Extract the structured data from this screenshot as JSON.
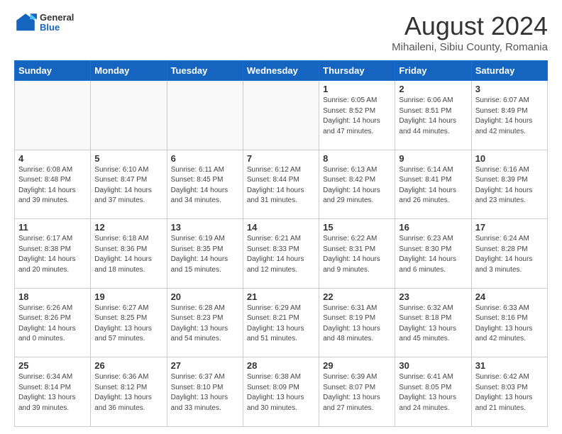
{
  "header": {
    "logo": {
      "line1": "General",
      "line2": "Blue"
    },
    "title": "August 2024",
    "location": "Mihaileni, Sibiu County, Romania"
  },
  "weekdays": [
    "Sunday",
    "Monday",
    "Tuesday",
    "Wednesday",
    "Thursday",
    "Friday",
    "Saturday"
  ],
  "weeks": [
    [
      {
        "day": "",
        "info": ""
      },
      {
        "day": "",
        "info": ""
      },
      {
        "day": "",
        "info": ""
      },
      {
        "day": "",
        "info": ""
      },
      {
        "day": "1",
        "info": "Sunrise: 6:05 AM\nSunset: 8:52 PM\nDaylight: 14 hours\nand 47 minutes."
      },
      {
        "day": "2",
        "info": "Sunrise: 6:06 AM\nSunset: 8:51 PM\nDaylight: 14 hours\nand 44 minutes."
      },
      {
        "day": "3",
        "info": "Sunrise: 6:07 AM\nSunset: 8:49 PM\nDaylight: 14 hours\nand 42 minutes."
      }
    ],
    [
      {
        "day": "4",
        "info": "Sunrise: 6:08 AM\nSunset: 8:48 PM\nDaylight: 14 hours\nand 39 minutes."
      },
      {
        "day": "5",
        "info": "Sunrise: 6:10 AM\nSunset: 8:47 PM\nDaylight: 14 hours\nand 37 minutes."
      },
      {
        "day": "6",
        "info": "Sunrise: 6:11 AM\nSunset: 8:45 PM\nDaylight: 14 hours\nand 34 minutes."
      },
      {
        "day": "7",
        "info": "Sunrise: 6:12 AM\nSunset: 8:44 PM\nDaylight: 14 hours\nand 31 minutes."
      },
      {
        "day": "8",
        "info": "Sunrise: 6:13 AM\nSunset: 8:42 PM\nDaylight: 14 hours\nand 29 minutes."
      },
      {
        "day": "9",
        "info": "Sunrise: 6:14 AM\nSunset: 8:41 PM\nDaylight: 14 hours\nand 26 minutes."
      },
      {
        "day": "10",
        "info": "Sunrise: 6:16 AM\nSunset: 8:39 PM\nDaylight: 14 hours\nand 23 minutes."
      }
    ],
    [
      {
        "day": "11",
        "info": "Sunrise: 6:17 AM\nSunset: 8:38 PM\nDaylight: 14 hours\nand 20 minutes."
      },
      {
        "day": "12",
        "info": "Sunrise: 6:18 AM\nSunset: 8:36 PM\nDaylight: 14 hours\nand 18 minutes."
      },
      {
        "day": "13",
        "info": "Sunrise: 6:19 AM\nSunset: 8:35 PM\nDaylight: 14 hours\nand 15 minutes."
      },
      {
        "day": "14",
        "info": "Sunrise: 6:21 AM\nSunset: 8:33 PM\nDaylight: 14 hours\nand 12 minutes."
      },
      {
        "day": "15",
        "info": "Sunrise: 6:22 AM\nSunset: 8:31 PM\nDaylight: 14 hours\nand 9 minutes."
      },
      {
        "day": "16",
        "info": "Sunrise: 6:23 AM\nSunset: 8:30 PM\nDaylight: 14 hours\nand 6 minutes."
      },
      {
        "day": "17",
        "info": "Sunrise: 6:24 AM\nSunset: 8:28 PM\nDaylight: 14 hours\nand 3 minutes."
      }
    ],
    [
      {
        "day": "18",
        "info": "Sunrise: 6:26 AM\nSunset: 8:26 PM\nDaylight: 14 hours\nand 0 minutes."
      },
      {
        "day": "19",
        "info": "Sunrise: 6:27 AM\nSunset: 8:25 PM\nDaylight: 13 hours\nand 57 minutes."
      },
      {
        "day": "20",
        "info": "Sunrise: 6:28 AM\nSunset: 8:23 PM\nDaylight: 13 hours\nand 54 minutes."
      },
      {
        "day": "21",
        "info": "Sunrise: 6:29 AM\nSunset: 8:21 PM\nDaylight: 13 hours\nand 51 minutes."
      },
      {
        "day": "22",
        "info": "Sunrise: 6:31 AM\nSunset: 8:19 PM\nDaylight: 13 hours\nand 48 minutes."
      },
      {
        "day": "23",
        "info": "Sunrise: 6:32 AM\nSunset: 8:18 PM\nDaylight: 13 hours\nand 45 minutes."
      },
      {
        "day": "24",
        "info": "Sunrise: 6:33 AM\nSunset: 8:16 PM\nDaylight: 13 hours\nand 42 minutes."
      }
    ],
    [
      {
        "day": "25",
        "info": "Sunrise: 6:34 AM\nSunset: 8:14 PM\nDaylight: 13 hours\nand 39 minutes."
      },
      {
        "day": "26",
        "info": "Sunrise: 6:36 AM\nSunset: 8:12 PM\nDaylight: 13 hours\nand 36 minutes."
      },
      {
        "day": "27",
        "info": "Sunrise: 6:37 AM\nSunset: 8:10 PM\nDaylight: 13 hours\nand 33 minutes."
      },
      {
        "day": "28",
        "info": "Sunrise: 6:38 AM\nSunset: 8:09 PM\nDaylight: 13 hours\nand 30 minutes."
      },
      {
        "day": "29",
        "info": "Sunrise: 6:39 AM\nSunset: 8:07 PM\nDaylight: 13 hours\nand 27 minutes."
      },
      {
        "day": "30",
        "info": "Sunrise: 6:41 AM\nSunset: 8:05 PM\nDaylight: 13 hours\nand 24 minutes."
      },
      {
        "day": "31",
        "info": "Sunrise: 6:42 AM\nSunset: 8:03 PM\nDaylight: 13 hours\nand 21 minutes."
      }
    ]
  ]
}
